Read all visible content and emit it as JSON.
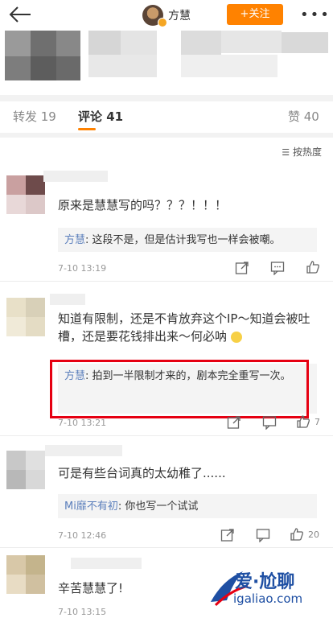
{
  "header": {
    "author": "方慧",
    "follow_label": "+关注",
    "more_glyph": "•••"
  },
  "tabs": [
    {
      "label": "转发 19",
      "active": false
    },
    {
      "label": "评论 41",
      "active": true
    },
    {
      "label": "赞 40",
      "active": false
    }
  ],
  "sort_label": "按热度",
  "comments": [
    {
      "text": "原来是慧慧写的吗？？？！！！",
      "reply_author": "方慧",
      "reply_text": "这段不是，但是估计我写也一样会被嘲。",
      "time": "7-10 13:19",
      "likes": ""
    },
    {
      "text": "知道有限制，还是不肯放弃这个IP～知道会被吐槽，还是要花钱排出来～何必呐",
      "reply_author": "方慧",
      "reply_text": "拍到一半限制才来的，剧本完全重写一次。",
      "time": "7-10 13:21",
      "likes": "7"
    },
    {
      "text": "可是有些台词真的太幼稚了......",
      "reply_author": "Mi靡不有初",
      "reply_text": "你也写一个试试",
      "time": "7-10 12:46",
      "likes": "20"
    },
    {
      "text": "辛苦慧慧了!",
      "time": "7-10 13:15"
    }
  ],
  "watermark": {
    "title": "爱·尬聊",
    "url": "igaliao.com"
  },
  "colors": {
    "accent": "#ff8200",
    "highlight_box": "#e60012",
    "reply_name": "#5b7fbc"
  }
}
